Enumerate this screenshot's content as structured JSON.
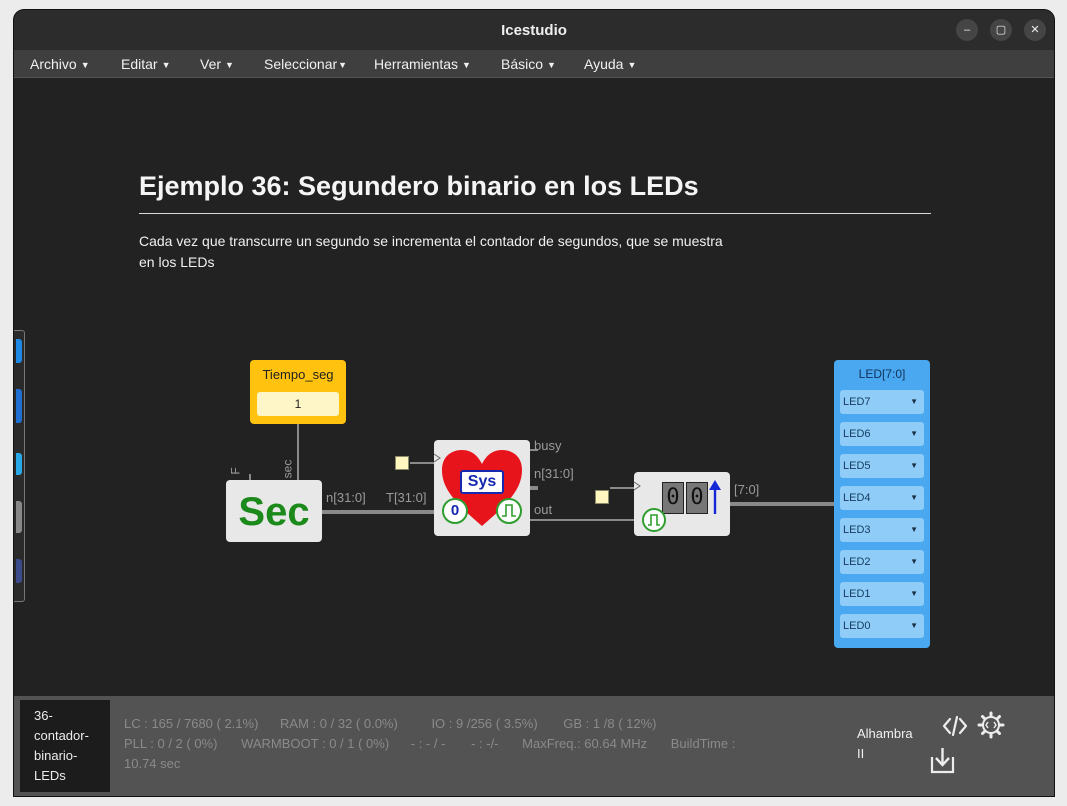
{
  "window": {
    "title": "Icestudio",
    "controls": {
      "minimize": "–",
      "maximize": "▢",
      "close": "✕"
    }
  },
  "menu": [
    {
      "label": "Archivo"
    },
    {
      "label": "Editar"
    },
    {
      "label": "Ver"
    },
    {
      "label": "Seleccionar"
    },
    {
      "label": "Herramientas"
    },
    {
      "label": "Básico"
    },
    {
      "label": "Ayuda"
    }
  ],
  "info": {
    "title": "Ejemplo 36: Segundero binario en los LEDs",
    "description": "Cada vez que transcurre un segundo se incrementa el contador de segundos, que se muestra en los LEDs"
  },
  "circuit": {
    "constant": {
      "name": "Tiempo_seg",
      "value": "1"
    },
    "sec_block": {
      "text": "Sec",
      "pins_top": [
        "F",
        "sec"
      ],
      "output": "n[31:0]"
    },
    "sys_block": {
      "text": "Sys",
      "badge": "0",
      "input": "T[31:0]",
      "outputs": [
        "busy",
        "n[31:0]",
        "out"
      ]
    },
    "counter": {
      "digits": [
        "0",
        "0"
      ],
      "output": "[7:0]"
    },
    "leds": {
      "title": "LED[7:0]",
      "items": [
        "LED7",
        "LED6",
        "LED5",
        "LED4",
        "LED3",
        "LED2",
        "LED1",
        "LED0"
      ]
    }
  },
  "footer": {
    "filename_lines": [
      "36-",
      "contador-",
      "binario-",
      "LEDs"
    ],
    "stats": {
      "lc": "LC : 165 / 7680 ( 2.1%)",
      "ram": "RAM : 0 / 32 ( 0.0%)",
      "io": "IO :  9 /256  ( 3.5%)",
      "gb": "GB :  1 /8  ( 12%)",
      "pll": "PLL : 0 / 2 ( 0%)",
      "warmboot": "WARMBOOT : 0 / 1 ( 0%)",
      "misc1": "- : - / -",
      "misc2": "- :  -/-",
      "maxfreq": "MaxFreq.:  60.64 MHz",
      "buildtime": "BuildTime :",
      "buildtime_value": "10.74 sec"
    },
    "board_lines": [
      "Alhambra",
      "II"
    ],
    "icons": [
      "code-icon",
      "settings-gear-icon",
      "download-icon"
    ]
  },
  "colors": {
    "background": "#222222",
    "constant_block": "#ffc20e",
    "led_block": "#4aa8f0",
    "sec_text": "#1b8a1b",
    "heart": "#e8141b"
  }
}
